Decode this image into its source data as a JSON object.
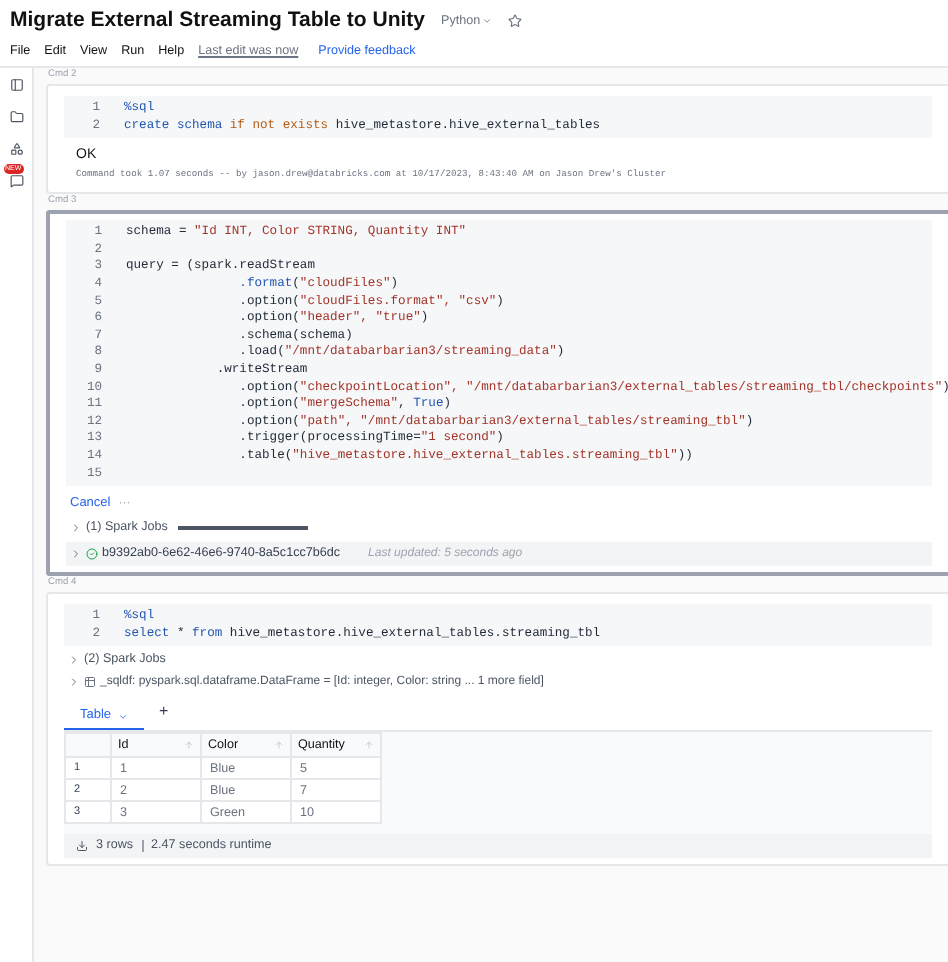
{
  "notebook": {
    "title": "Migrate External Streaming Table to Unity",
    "language": "Python",
    "menu": [
      "File",
      "Edit",
      "View",
      "Run",
      "Help"
    ],
    "last_edit": "Last edit was now",
    "feedback": "Provide feedback"
  },
  "sidebar": {
    "badge": "NEW"
  },
  "cells": [
    {
      "label": "Cmd 2",
      "selected": false,
      "lines": [
        {
          "n": "1",
          "segs": [
            {
              "kind": "keyword",
              "t": "%sql"
            }
          ]
        },
        {
          "n": "2",
          "segs": [
            {
              "kind": "keyword",
              "t": "create schema "
            },
            {
              "kind": "operator",
              "t": "if not exists "
            },
            {
              "kind": "plain",
              "t": "hive_metastore.hive_external_tables"
            }
          ]
        }
      ],
      "outputs": [
        {
          "kind": "text",
          "t": "OK"
        },
        {
          "kind": "meta",
          "t": "Command took 1.07 seconds -- by jason.drew@databricks.com at 10/17/2023, 8:43:40 AM on Jason Drew's Cluster"
        }
      ]
    },
    {
      "label": "Cmd 3",
      "selected": true,
      "lines": [
        {
          "n": "1",
          "segs": [
            {
              "kind": "plain",
              "t": "schema = "
            },
            {
              "kind": "string",
              "t": "\"Id INT, Color STRING, Quantity INT\""
            }
          ]
        },
        {
          "n": "2"
        },
        {
          "n": "3",
          "segs": [
            {
              "kind": "plain",
              "t": "query = (spark.readStream"
            }
          ]
        },
        {
          "n": "4",
          "segs": [
            {
              "kind": "method",
              "t": "               .format"
            },
            {
              "kind": "plain",
              "t": "("
            },
            {
              "kind": "string",
              "t": "\"cloudFiles\""
            },
            {
              "kind": "plain",
              "t": ")"
            }
          ]
        },
        {
          "n": "5",
          "segs": [
            {
              "kind": "plain",
              "t": "               .option("
            },
            {
              "kind": "string",
              "t": "\"cloudFiles.format\", \"csv\""
            },
            {
              "kind": "plain",
              "t": ")"
            }
          ]
        },
        {
          "n": "6",
          "segs": [
            {
              "kind": "plain",
              "t": "               .option("
            },
            {
              "kind": "string",
              "t": "\"header\", \"true\""
            },
            {
              "kind": "plain",
              "t": ")"
            }
          ]
        },
        {
          "n": "7",
          "segs": [
            {
              "kind": "plain",
              "t": "               .schema(schema)"
            }
          ]
        },
        {
          "n": "8",
          "segs": [
            {
              "kind": "plain",
              "t": "               .load("
            },
            {
              "kind": "string",
              "t": "\"/mnt/databarbarian3/streaming_data\""
            },
            {
              "kind": "plain",
              "t": ")"
            }
          ]
        },
        {
          "n": "9",
          "segs": [
            {
              "kind": "plain",
              "t": "            .writeStream"
            }
          ]
        },
        {
          "n": "10",
          "segs": [
            {
              "kind": "plain",
              "t": "               .option("
            },
            {
              "kind": "string",
              "t": "\"checkpointLocation\", \"/mnt/databarbarian3/external_tables/streaming_tbl/checkpoints\""
            },
            {
              "kind": "plain",
              "t": ")"
            }
          ]
        },
        {
          "n": "11",
          "segs": [
            {
              "kind": "plain",
              "t": "               .option("
            },
            {
              "kind": "string",
              "t": "\"mergeSchema\""
            },
            {
              "kind": "plain",
              "t": ", "
            },
            {
              "kind": "keyword",
              "t": "True"
            },
            {
              "kind": "plain",
              "t": ")"
            }
          ]
        },
        {
          "n": "12",
          "segs": [
            {
              "kind": "plain",
              "t": "               .option("
            },
            {
              "kind": "string",
              "t": "\"path\", \"/mnt/databarbarian3/external_tables/streaming_tbl\""
            },
            {
              "kind": "plain",
              "t": ")"
            }
          ]
        },
        {
          "n": "13",
          "segs": [
            {
              "kind": "plain",
              "t": "               .trigger(processingTime="
            },
            {
              "kind": "string",
              "t": "\"1 second\""
            },
            {
              "kind": "plain",
              "t": ")"
            }
          ]
        },
        {
          "n": "14",
          "segs": [
            {
              "kind": "plain",
              "t": "               .table("
            },
            {
              "kind": "string",
              "t": "\"hive_metastore.hive_external_tables.streaming_tbl\""
            },
            {
              "kind": "plain",
              "t": "))"
            }
          ]
        },
        {
          "n": "15"
        }
      ],
      "outputs": [
        {
          "kind": "cancel",
          "t": "Cancel",
          "more": "···"
        },
        {
          "kind": "jobs",
          "t": "(1) Spark Jobs",
          "expanded": false,
          "level": 1
        },
        {
          "kind": "stream",
          "t": "b9392ab0-6e62-46e6-9740-8a5c1cc7b6dc",
          "updated": "Last updated: 5 seconds ago",
          "expanded": false
        }
      ]
    },
    {
      "label": "Cmd 4",
      "selected": false,
      "lines": [
        {
          "n": "1",
          "segs": [
            {
              "kind": "keyword",
              "t": "%sql"
            }
          ]
        },
        {
          "n": "2",
          "segs": [
            {
              "kind": "keyword",
              "t": "select "
            },
            {
              "kind": "plain",
              "t": "* "
            },
            {
              "kind": "keyword",
              "t": "from "
            },
            {
              "kind": "plain",
              "t": "hive_metastore.hive_external_tables.streaming_tbl"
            }
          ]
        }
      ],
      "outputs": [
        {
          "kind": "jobs",
          "t": "(2) Spark Jobs",
          "expanded": false
        },
        {
          "kind": "dataframe",
          "t": "_sqldf:  pyspark.sql.dataframe.DataFrame = [Id: integer, Color: string ... 1 more field]",
          "expanded": false
        },
        {
          "kind": "table",
          "tabs": [
            {
              "label": "Table",
              "selected": true
            }
          ],
          "add": "+",
          "columns": [
            "Id",
            "Color",
            "Quantity"
          ],
          "rows": [
            {
              "index": "1",
              "cells": [
                "1",
                "Blue",
                "5"
              ]
            },
            {
              "index": "2",
              "cells": [
                "2",
                "Blue",
                "7"
              ]
            },
            {
              "index": "3",
              "cells": [
                "3",
                "Green",
                "10"
              ]
            }
          ],
          "row_count": "3 rows",
          "runtime": "2.47 seconds runtime"
        }
      ]
    }
  ]
}
